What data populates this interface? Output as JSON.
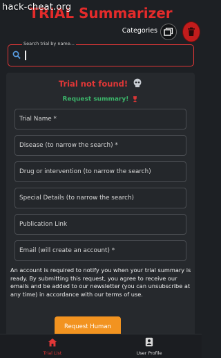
{
  "watermark": "hack-cheat.org",
  "header": {
    "title": "TRIAL Summarizer",
    "categories_label": "Categories"
  },
  "search": {
    "label": "Search trial by name...",
    "value": ""
  },
  "status": {
    "not_found": "Trial not found!",
    "request_summary": "Request summary!"
  },
  "form": {
    "fields": [
      "Trial Name *",
      "Disease (to narrow the search) *",
      "Drug or intervention (to narrow the search)",
      "Special Details (to narrow the search)",
      "Publication Link",
      "Email (will create an account) *"
    ],
    "notice": "An account is required to notify you when your trial summary is ready. By submitting this request, you agree to receive our emails and be added to our newsletter (you can unsubscribe at any time) in accordance with our terms of use.",
    "submit_label": "Request Human Review!"
  },
  "nav": {
    "trials_label": "Trial List",
    "profile_label": "User Profile"
  },
  "colors": {
    "accent_red": "#e33737",
    "success_green": "#3bb56a",
    "cta_orange": "#f29320",
    "background": "#1d2024",
    "card": "#26292d"
  },
  "icons": {
    "categories": "folders-icon",
    "delete": "trash-icon",
    "search": "search-icon",
    "not_found": "skull-icon",
    "request": "trophy-icon",
    "trials": "home-icon",
    "profile": "user-badge-icon"
  }
}
